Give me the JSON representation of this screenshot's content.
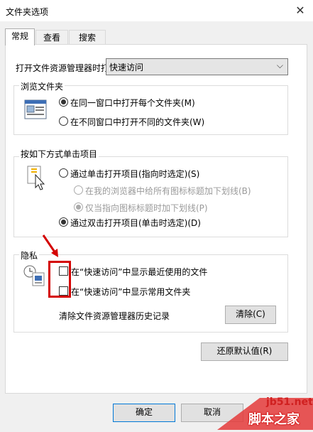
{
  "window": {
    "title": "文件夹选项",
    "close_glyph": "✕"
  },
  "tabs": [
    {
      "label": "常规",
      "active": true
    },
    {
      "label": "查看",
      "active": false
    },
    {
      "label": "搜索",
      "active": false
    }
  ],
  "open_in": {
    "label": "打开文件资源管理器时打",
    "value": "快速访问",
    "arrow": "⌵"
  },
  "browse": {
    "title": "浏览文件夹",
    "options": [
      {
        "label": "在同一窗口中打开每个文件夹(M)",
        "checked": true
      },
      {
        "label": "在不同窗口中打开不同的文件夹(W)",
        "checked": false
      }
    ]
  },
  "click": {
    "title": "按如下方式单击项目",
    "single": {
      "label": "通过单击打开项目(指向时选定)(S)",
      "checked": false
    },
    "underline_all": {
      "label": "在我的浏览器中给所有图标标题加下划线(B)",
      "checked": false,
      "disabled": true
    },
    "underline_point": {
      "label": "仅当指向图标标题时加下划线(P)",
      "checked": true,
      "disabled": true
    },
    "double": {
      "label": "通过双击打开项目(单击时选定)(D)",
      "checked": true
    }
  },
  "privacy": {
    "title": "隐私",
    "recent_files": {
      "label": "在“快速访问”中显示最近使用的文件",
      "checked": false
    },
    "frequent_folders": {
      "label": "在“快速访问”中显示常用文件夹",
      "checked": false
    },
    "clear_label": "清除文件资源管理器历史记录",
    "clear_button": "清除(C)"
  },
  "restore_button": "还原默认值(R)",
  "footer": {
    "ok": "确定",
    "cancel": "取消"
  },
  "watermark": {
    "site": "jb51.net",
    "name": "脚本之家"
  },
  "colors": {
    "highlight": "#d40000",
    "accent": "#0078d7"
  }
}
